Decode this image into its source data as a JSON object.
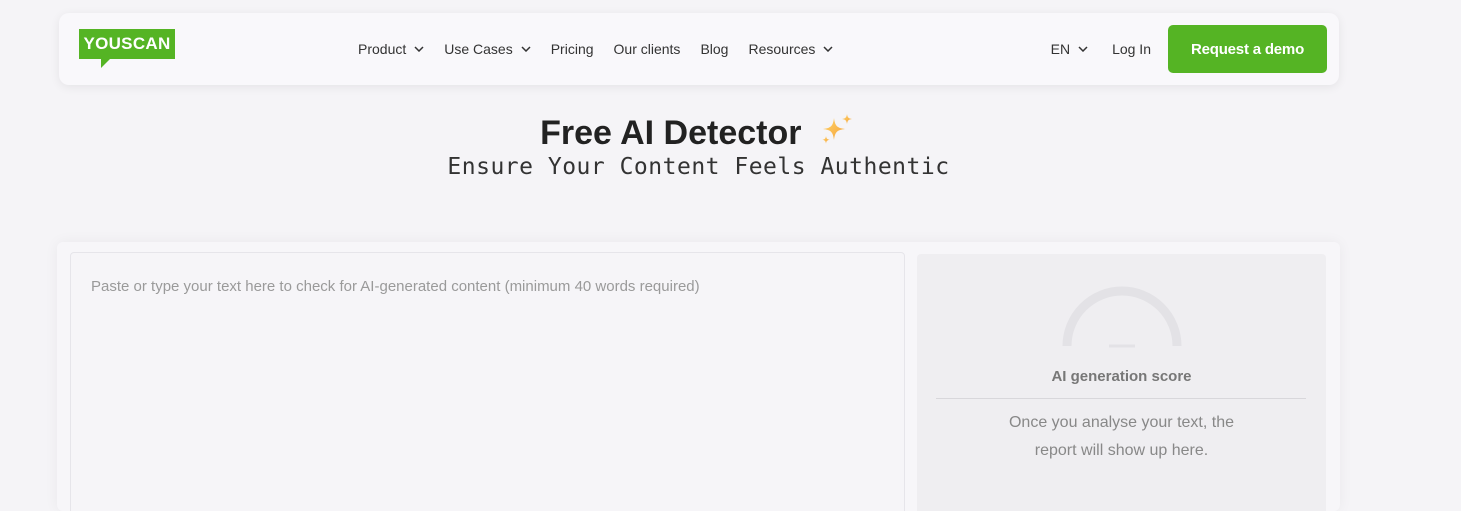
{
  "brand": {
    "logo_text": "YOUSCAN",
    "color": "#55b424"
  },
  "nav": {
    "items": [
      {
        "label": "Product",
        "has_dropdown": true
      },
      {
        "label": "Use Cases",
        "has_dropdown": true
      },
      {
        "label": "Pricing",
        "has_dropdown": false
      },
      {
        "label": "Our clients",
        "has_dropdown": false
      },
      {
        "label": "Blog",
        "has_dropdown": false
      },
      {
        "label": "Resources",
        "has_dropdown": true
      }
    ],
    "language": "EN",
    "login_label": "Log In",
    "cta_label": "Request a demo"
  },
  "hero": {
    "title": "Free AI Detector",
    "title_icon": "sparkles-icon",
    "subtitle": "Ensure Your Content Feels Authentic"
  },
  "detector": {
    "input_placeholder": "Paste or type your text here to check for AI-generated content (minimum 40 words required)",
    "input_value": "",
    "score_label": "AI generation score",
    "score_empty_text": "Once you analyse your text, the report will show up here."
  }
}
